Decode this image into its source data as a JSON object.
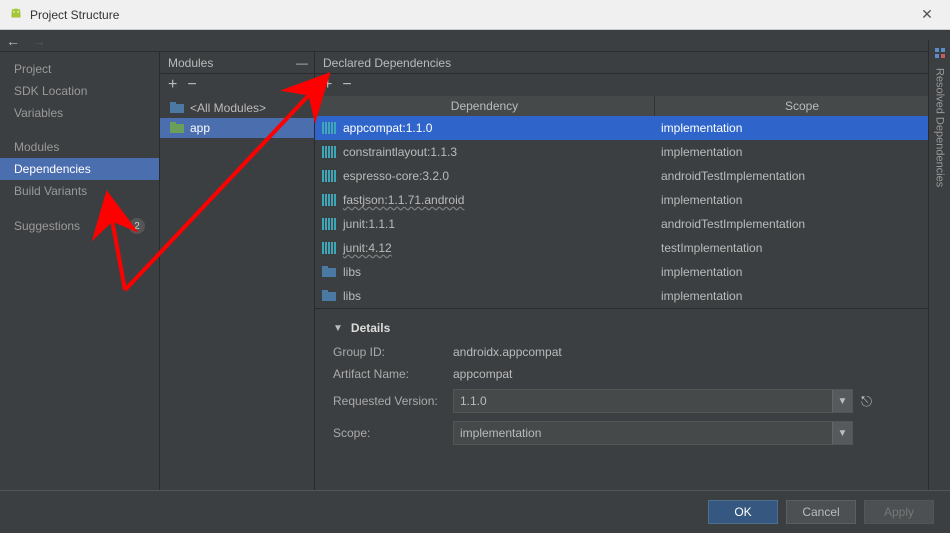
{
  "window": {
    "title": "Project Structure"
  },
  "nav": {
    "items": [
      {
        "label": "Project",
        "selected": false
      },
      {
        "label": "SDK Location",
        "selected": false
      },
      {
        "label": "Variables",
        "selected": false
      }
    ],
    "items2": [
      {
        "label": "Modules",
        "selected": false
      },
      {
        "label": "Dependencies",
        "selected": true
      },
      {
        "label": "Build Variants",
        "selected": false
      }
    ],
    "items3": [
      {
        "label": "Suggestions",
        "selected": false,
        "badge": "2"
      }
    ]
  },
  "modules": {
    "header": "Modules",
    "items": [
      {
        "label": "<All Modules>",
        "selected": false
      },
      {
        "label": "app",
        "selected": true
      }
    ]
  },
  "deps": {
    "header": "Declared Dependencies",
    "columns": {
      "c1": "Dependency",
      "c2": "Scope"
    },
    "rows": [
      {
        "name": "appcompat:1.1.0",
        "scope": "implementation",
        "selected": true,
        "icon": "bars"
      },
      {
        "name": "constraintlayout:1.1.3",
        "scope": "implementation",
        "icon": "bars"
      },
      {
        "name": "espresso-core:3.2.0",
        "scope": "androidTestImplementation",
        "icon": "bars"
      },
      {
        "name": "fastjson:1.1.71.android",
        "scope": "implementation",
        "icon": "bars",
        "wavy": true
      },
      {
        "name": "junit:1.1.1",
        "scope": "androidTestImplementation",
        "icon": "bars"
      },
      {
        "name": "junit:4.12",
        "scope": "testImplementation",
        "icon": "bars",
        "wavy": true
      },
      {
        "name": "libs",
        "scope": "implementation",
        "icon": "folder"
      },
      {
        "name": "libs",
        "scope": "implementation",
        "icon": "folder"
      }
    ]
  },
  "details": {
    "title": "Details",
    "groupIdLabel": "Group ID:",
    "groupId": "androidx.appcompat",
    "artifactLabel": "Artifact Name:",
    "artifact": "appcompat",
    "versionLabel": "Requested Version:",
    "version": "1.1.0",
    "scopeLabel": "Scope:",
    "scope": "implementation"
  },
  "rightTab": {
    "label": "Resolved Dependencies"
  },
  "footer": {
    "ok": "OK",
    "cancel": "Cancel",
    "apply": "Apply"
  }
}
